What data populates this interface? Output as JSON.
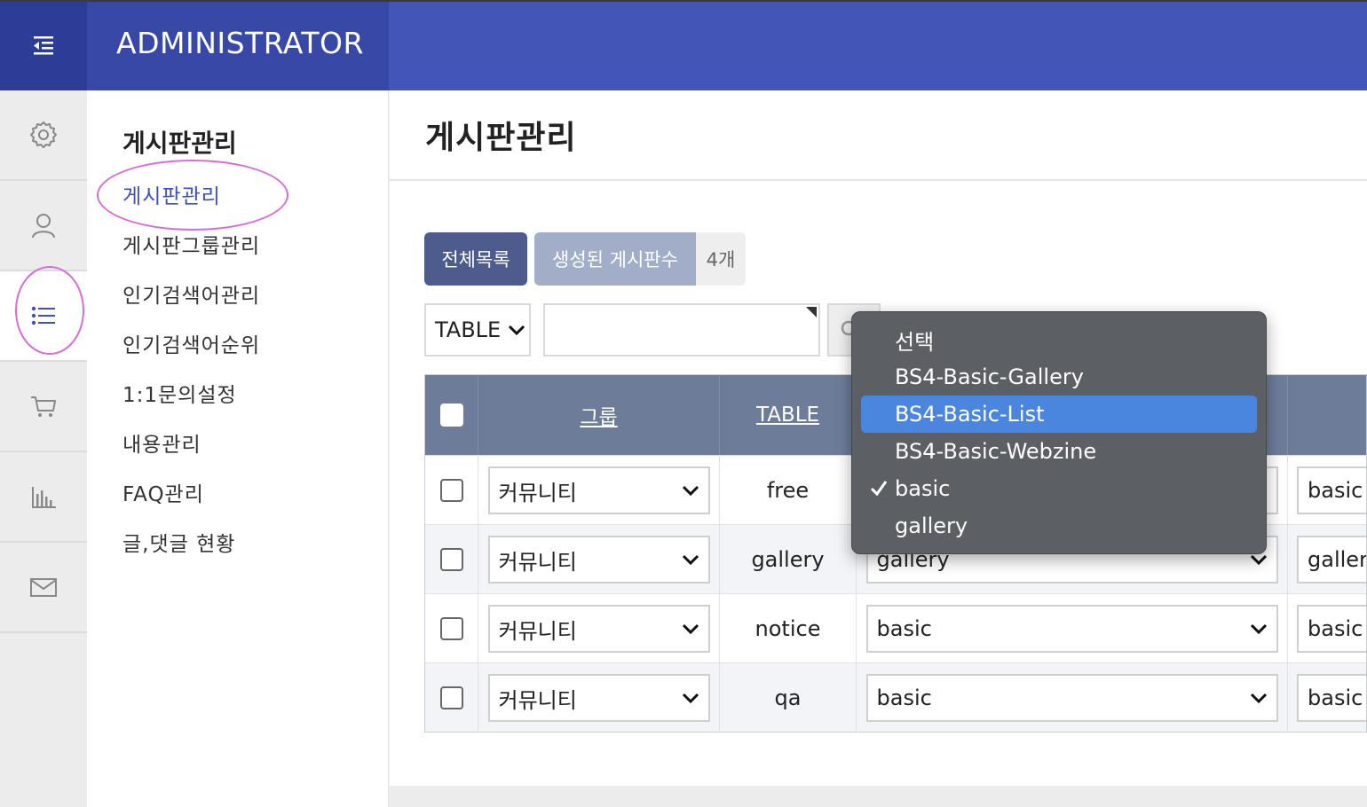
{
  "header": {
    "brand": "ADMINISTRATOR",
    "menu_icon": "indent-menu-icon"
  },
  "rail": {
    "items": [
      "gear-icon",
      "user-icon",
      "list-icon",
      "cart-icon",
      "chart-icon",
      "mail-icon"
    ],
    "active_index": 2
  },
  "submenu": {
    "title": "게시판관리",
    "items": [
      "게시판관리",
      "게시판그룹관리",
      "인기검색어관리",
      "인기검색어순위",
      "1:1문의설정",
      "내용관리",
      "FAQ관리",
      "글,댓글 현황"
    ],
    "current_index": 0
  },
  "main": {
    "title": "게시판관리",
    "all_list_button": "전체목록",
    "created_count_label": "생성된 게시판수",
    "created_count_value": "4개",
    "search_field": {
      "selected": "TABLE",
      "value": ""
    }
  },
  "table": {
    "headers": [
      "그룹",
      "TABLE"
    ],
    "rows": [
      {
        "group": "커뮤니티",
        "table": "free",
        "skin": "basic",
        "mobile_skin": "basic"
      },
      {
        "group": "커뮤니티",
        "table": "gallery",
        "skin": "gallery",
        "mobile_skin": "gallery"
      },
      {
        "group": "커뮤니티",
        "table": "notice",
        "skin": "basic",
        "mobile_skin": "basic"
      },
      {
        "group": "커뮤니티",
        "table": "qa",
        "skin": "basic",
        "mobile_skin": "basic"
      }
    ]
  },
  "dropdown": {
    "options": [
      "선택",
      "BS4-Basic-Gallery",
      "BS4-Basic-List",
      "BS4-Basic-Webzine",
      "basic",
      "gallery"
    ],
    "highlighted_index": 2,
    "checked_index": 4
  },
  "colors": {
    "topbar": "#4355b7",
    "accent": "#3d4fc0",
    "table_header": "#6d7c99",
    "highlight": "#4a86dd",
    "annotation": "#d86bd8"
  }
}
